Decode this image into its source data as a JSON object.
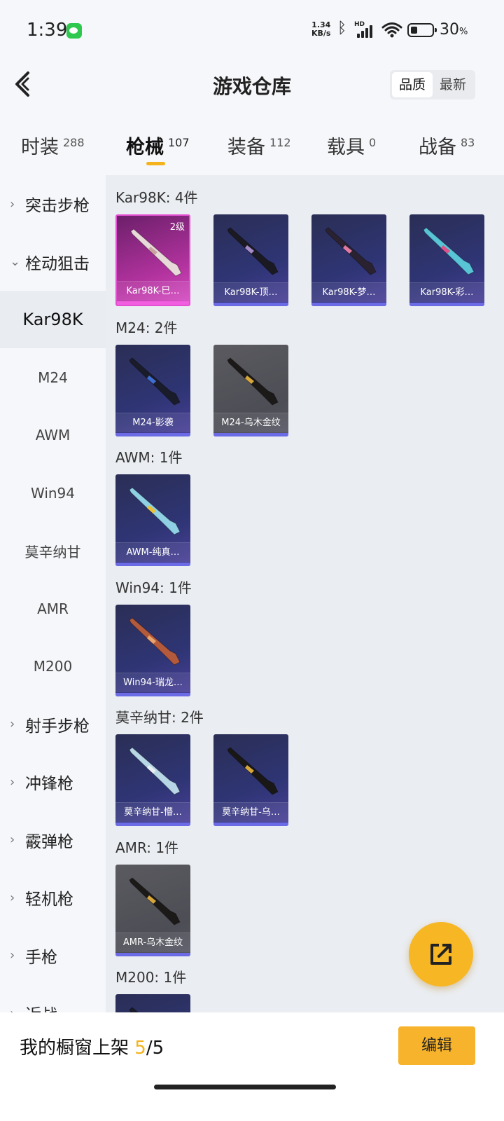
{
  "status_bar": {
    "time": "1:39",
    "net_speed_value": "1.34",
    "net_speed_unit": "KB/s",
    "hd": "HD",
    "battery": "30",
    "battery_unit": "%"
  },
  "header": {
    "title": "游戏仓库",
    "sort_options": [
      "品质",
      "最新"
    ],
    "sort_selected": "品质"
  },
  "tabs": [
    {
      "label": "时装",
      "count": "288"
    },
    {
      "label": "枪械",
      "count": "107",
      "active": true
    },
    {
      "label": "装备",
      "count": "112"
    },
    {
      "label": "载具",
      "count": "0"
    },
    {
      "label": "战备",
      "count": "83"
    }
  ],
  "sidebar": {
    "items": [
      {
        "label": "突击步枪",
        "type": "group",
        "expanded": false
      },
      {
        "label": "栓动狙击",
        "type": "group",
        "expanded": true
      },
      {
        "label": "Kar98K",
        "type": "sub",
        "selected": true
      },
      {
        "label": "M24",
        "type": "sub"
      },
      {
        "label": "AWM",
        "type": "sub"
      },
      {
        "label": "Win94",
        "type": "sub"
      },
      {
        "label": "莫辛纳甘",
        "type": "sub"
      },
      {
        "label": "AMR",
        "type": "sub"
      },
      {
        "label": "M200",
        "type": "sub"
      },
      {
        "label": "射手步枪",
        "type": "group",
        "expanded": false
      },
      {
        "label": "冲锋枪",
        "type": "group",
        "expanded": false
      },
      {
        "label": "霰弹枪",
        "type": "group",
        "expanded": false
      },
      {
        "label": "轻机枪",
        "type": "group",
        "expanded": false
      },
      {
        "label": "手枪",
        "type": "group",
        "expanded": false
      },
      {
        "label": "近战",
        "type": "group",
        "expanded": false
      }
    ]
  },
  "sections": [
    {
      "title": "Kar98K: 4件",
      "items": [
        {
          "name": "Kar98K-巳…",
          "style": "pink",
          "level": "2级",
          "gun_color": "#e9dada",
          "accent": "#c9a3a0"
        },
        {
          "name": "Kar98K-顶…",
          "style": "blue",
          "gun_color": "#1b1a22",
          "accent": "#a88bc9"
        },
        {
          "name": "Kar98K-梦…",
          "style": "blue",
          "gun_color": "#2a2230",
          "accent": "#e07aa5"
        },
        {
          "name": "Kar98K-彩…",
          "style": "blue",
          "gun_color": "#58c4d6",
          "accent": "#e0508a"
        }
      ]
    },
    {
      "title": "M24: 2件",
      "items": [
        {
          "name": "M24-影袭",
          "style": "blue",
          "gun_color": "#1a1c2a",
          "accent": "#3f6fd4"
        },
        {
          "name": "M24-乌木金纹",
          "style": "gray",
          "gun_color": "#1c1a18",
          "accent": "#d7a73a"
        }
      ]
    },
    {
      "title": "AWM: 1件",
      "items": [
        {
          "name": "AWM-纯真…",
          "style": "blue",
          "gun_color": "#8fd0e4",
          "accent": "#e9c23b"
        }
      ]
    },
    {
      "title": "Win94: 1件",
      "items": [
        {
          "name": "Win94-瑞龙…",
          "style": "blue",
          "gun_color": "#b45a3c",
          "accent": "#e9a56e"
        }
      ]
    },
    {
      "title": "莫辛纳甘: 2件",
      "items": [
        {
          "name": "莫辛纳甘-懵…",
          "style": "blue",
          "gun_color": "#b7d7e6",
          "accent": "#e8eef2"
        },
        {
          "name": "莫辛纳甘-乌…",
          "style": "blue",
          "gun_color": "#1a1816",
          "accent": "#d7a73a"
        }
      ]
    },
    {
      "title": "AMR: 1件",
      "items": [
        {
          "name": "AMR-乌木金纹",
          "style": "gray",
          "gun_color": "#1c1a18",
          "accent": "#d7a73a"
        }
      ]
    },
    {
      "title": "M200: 1件",
      "items": [
        {
          "name": "",
          "style": "blue",
          "gun_color": "#1a1c2a",
          "accent": "#6b6be6"
        }
      ]
    }
  ],
  "bottom_bar": {
    "showcase_label": "我的橱窗上架",
    "showcase_current": "5",
    "showcase_separator": "/",
    "showcase_total": "5",
    "edit_label": "编辑"
  },
  "colors": {
    "accent": "#f4b21c",
    "card_blue": "#2f3575",
    "card_gray": "#4d4d55",
    "card_pink": "#b3339f"
  },
  "icons": {
    "back": "chevron-left-icon",
    "share": "external-link-icon",
    "bluetooth": "bluetooth-icon",
    "wifi": "wifi-icon",
    "battery": "battery-icon",
    "signal": "signal-icon",
    "wechat": "wechat-icon"
  }
}
